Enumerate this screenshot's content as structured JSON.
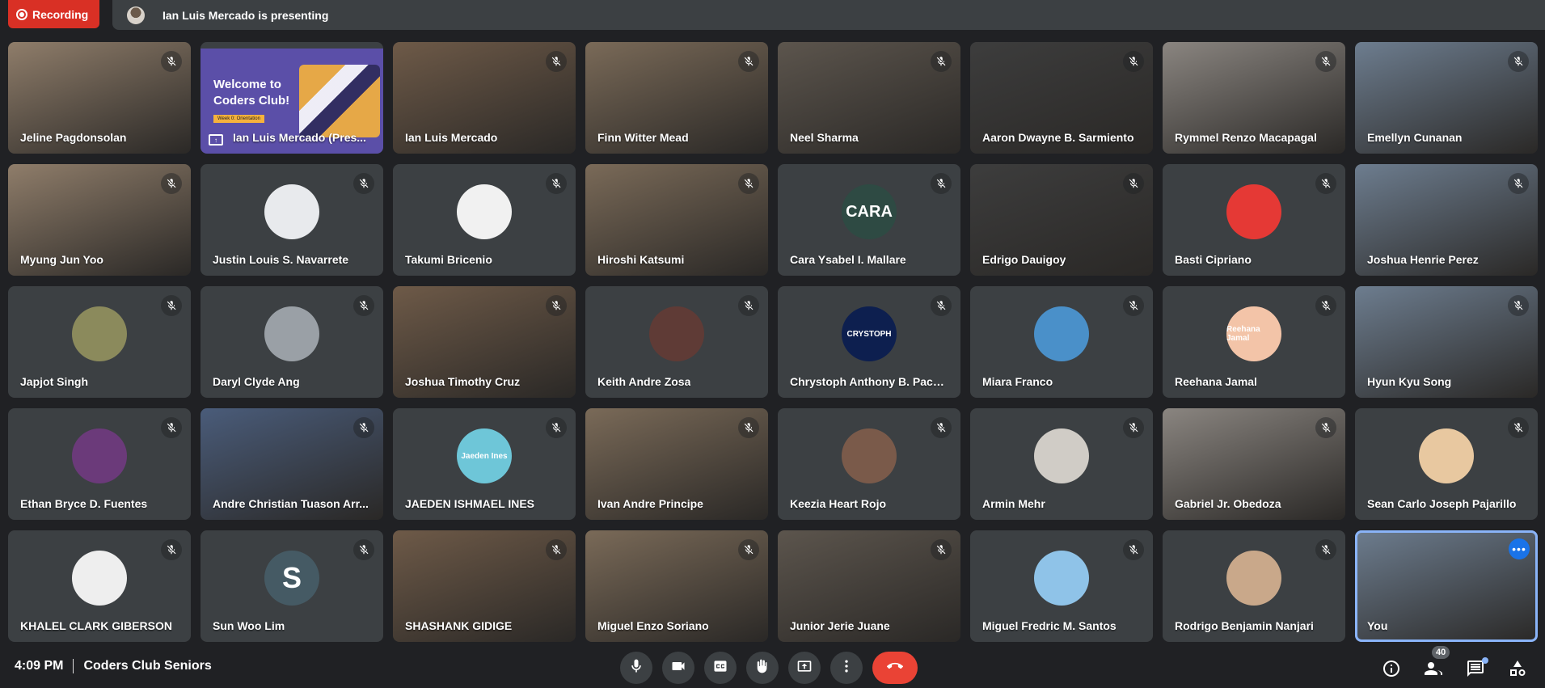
{
  "recording": {
    "label": "Recording",
    "color": "#d93025"
  },
  "presenting_banner": {
    "text": "Ian Luis Mercado is presenting"
  },
  "presentation": {
    "title_line1": "Welcome to",
    "title_line2": "Coders Club!",
    "tag": "Week 0: Orientation"
  },
  "participants": [
    {
      "name": "Jeline Pagdonsolan",
      "type": "video",
      "muted": true
    },
    {
      "name": "Ian Luis Mercado (Pres...",
      "type": "presentation",
      "muted": false
    },
    {
      "name": "Ian Luis Mercado",
      "type": "video",
      "muted": true
    },
    {
      "name": "Finn Witter Mead",
      "type": "video",
      "muted": true
    },
    {
      "name": "Neel Sharma",
      "type": "video",
      "muted": true
    },
    {
      "name": "Aaron Dwayne B. Sarmiento",
      "type": "video",
      "muted": true
    },
    {
      "name": "Rymmel Renzo Macapagal",
      "type": "video",
      "muted": true
    },
    {
      "name": "Emellyn Cunanan",
      "type": "video",
      "muted": true
    },
    {
      "name": "Myung Jun Yoo",
      "type": "video",
      "muted": true
    },
    {
      "name": "Justin Louis S. Navarrete",
      "type": "avatar",
      "muted": true,
      "avatar_text": "",
      "avatar_color": "#e8eaed"
    },
    {
      "name": "Takumi Bricenio",
      "type": "avatar",
      "muted": true,
      "avatar_text": "",
      "avatar_color": "#f1f1f1"
    },
    {
      "name": "Hiroshi Katsumi",
      "type": "video",
      "muted": true
    },
    {
      "name": "Cara Ysabel I. Mallare",
      "type": "avatar",
      "muted": true,
      "avatar_text": "CARA",
      "avatar_color": "#2e4a43"
    },
    {
      "name": "Edrigo Dauigoy",
      "type": "video",
      "muted": true
    },
    {
      "name": "Basti Cipriano",
      "type": "avatar",
      "muted": true,
      "avatar_text": "",
      "avatar_color": "#e53935"
    },
    {
      "name": "Joshua Henrie Perez",
      "type": "video",
      "muted": true
    },
    {
      "name": "Japjot Singh",
      "type": "avatar",
      "muted": true,
      "avatar_text": "",
      "avatar_color": "#8b8a5c"
    },
    {
      "name": "Daryl Clyde Ang",
      "type": "avatar",
      "muted": true,
      "avatar_text": "",
      "avatar_color": "#9aa0a6"
    },
    {
      "name": "Joshua Timothy Cruz",
      "type": "video",
      "muted": true
    },
    {
      "name": "Keith Andre Zosa",
      "type": "avatar",
      "muted": true,
      "avatar_text": "",
      "avatar_color": "#5f3b36"
    },
    {
      "name": "Chrystoph Anthony B. Pacu...",
      "type": "avatar",
      "muted": true,
      "avatar_text": "CRYSTOPH",
      "avatar_color": "#0d1f4f"
    },
    {
      "name": "Miara Franco",
      "type": "avatar",
      "muted": true,
      "avatar_text": "",
      "avatar_color": "#4a90c9"
    },
    {
      "name": "Reehana Jamal",
      "type": "avatar",
      "muted": true,
      "avatar_text": "Reehana Jamal",
      "avatar_color": "#f3c4a8"
    },
    {
      "name": "Hyun Kyu Song",
      "type": "video",
      "muted": true
    },
    {
      "name": "Ethan Bryce D. Fuentes",
      "type": "avatar",
      "muted": true,
      "avatar_text": "",
      "avatar_color": "#6b3a7a"
    },
    {
      "name": "Andre Christian Tuason Arr...",
      "type": "video",
      "muted": true
    },
    {
      "name": "JAEDEN ISHMAEL INES",
      "type": "avatar",
      "muted": true,
      "avatar_text": "Jaeden Ines",
      "avatar_color": "#6ec6d8"
    },
    {
      "name": "Ivan Andre Principe",
      "type": "video",
      "muted": true
    },
    {
      "name": "Keezia Heart Rojo",
      "type": "avatar",
      "muted": true,
      "avatar_text": "",
      "avatar_color": "#7a5a4a"
    },
    {
      "name": "Armin Mehr",
      "type": "avatar",
      "muted": true,
      "avatar_text": "",
      "avatar_color": "#d0ccc6"
    },
    {
      "name": "Gabriel Jr. Obedoza",
      "type": "video",
      "muted": true
    },
    {
      "name": "Sean Carlo Joseph Pajarillo",
      "type": "avatar",
      "muted": true,
      "avatar_text": "",
      "avatar_color": "#e8c8a0"
    },
    {
      "name": "KHALEL CLARK GIBERSON",
      "type": "avatar",
      "muted": true,
      "avatar_text": "",
      "avatar_color": "#eeeeee"
    },
    {
      "name": "Sun Woo Lim",
      "type": "avatar",
      "muted": true,
      "avatar_text": "S",
      "avatar_color": "#455a64"
    },
    {
      "name": "SHASHANK GIDIGE",
      "type": "video",
      "muted": true
    },
    {
      "name": "Miguel Enzo Soriano",
      "type": "video",
      "muted": true
    },
    {
      "name": "Junior Jerie Juane",
      "type": "video",
      "muted": true
    },
    {
      "name": "Miguel Fredric M. Santos",
      "type": "avatar",
      "muted": true,
      "avatar_text": "",
      "avatar_color": "#8fc3e8"
    },
    {
      "name": "Rodrigo Benjamin Nanjari",
      "type": "avatar",
      "muted": true,
      "avatar_text": "",
      "avatar_color": "#c9a88a"
    },
    {
      "name": "You",
      "type": "self",
      "muted": false
    }
  ],
  "bottom_bar": {
    "time": "4:09 PM",
    "meeting_name": "Coders Club Seniors",
    "controls": [
      "mic-icon",
      "camera-icon",
      "captions-icon",
      "raise-hand-icon",
      "present-icon",
      "more-options-icon",
      "end-call-icon"
    ],
    "right_controls": [
      "info-icon",
      "people-icon",
      "chat-icon",
      "activities-icon"
    ],
    "participant_count": "40",
    "end_call_color": "#ea4335"
  }
}
